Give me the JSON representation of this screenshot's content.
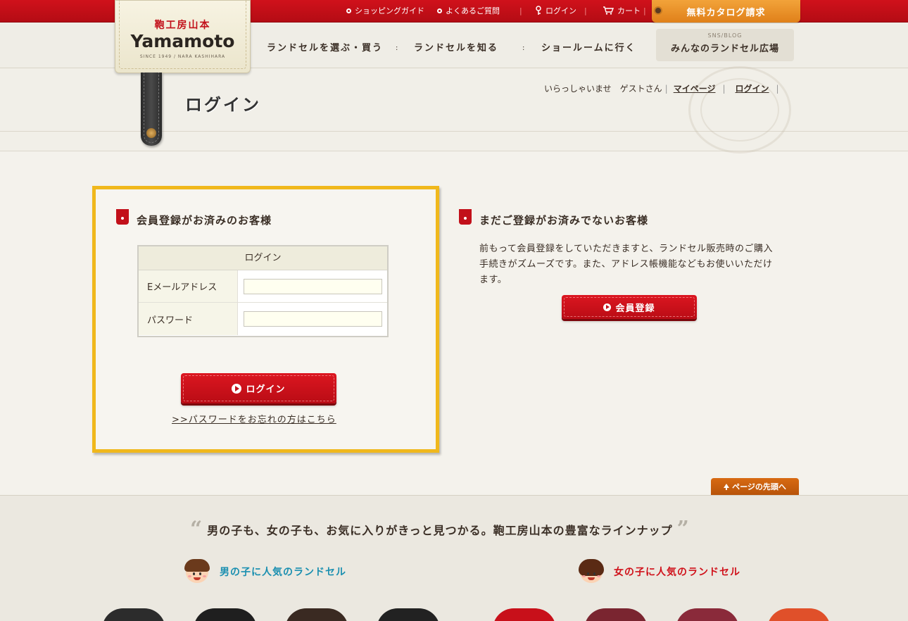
{
  "topbar": {
    "links": [
      {
        "label": "ショッピングガイド"
      },
      {
        "label": "よくあるご質問"
      },
      {
        "label": "ログイン"
      },
      {
        "label": "カート"
      }
    ],
    "catalog_label": "無料カタログ請求"
  },
  "logo": {
    "jp": "鞄工房山本",
    "en": "Yamamoto",
    "since": "SINCE 1949 / NARA KASHIHARA"
  },
  "mainnav": [
    {
      "label": "ランドセルを選ぶ・買う"
    },
    {
      "label": "ランドセルを知る"
    },
    {
      "label": "ショールームに行く"
    }
  ],
  "sns": {
    "small": "SNS/BLOG",
    "label": "みんなのランドセル広場"
  },
  "page_title": "ログイン",
  "greeting": {
    "text": "いらっしゃいませ　ゲストさん",
    "mypage": "マイページ",
    "login": "ログイン"
  },
  "member": {
    "heading": "会員登録がお済みのお客様",
    "table_header": "ログイン",
    "email_label": "Eメールアドレス",
    "email_value": "",
    "password_label": "パスワード",
    "password_value": "",
    "login_button": "ログイン",
    "forgot_link": ">>パスワードをお忘れの方はこちら"
  },
  "guest": {
    "heading": "まだご登録がお済みでないお客様",
    "intro": "前もって会員登録をしていただきますと、ランドセル販売時のご購入手続きがズムーズです。また、アドレス帳機能などもお使いいただけます。",
    "register_button": "会員登録"
  },
  "pagetop_label": "ページの先頭へ",
  "lineup": {
    "title": "男の子も、女の子も、お気に入りがきっと見つかる。鞄工房山本の豊富なラインナップ",
    "boys_label": "男の子に人気のランドセル",
    "girls_label": "女の子に人気のランドセル"
  },
  "colors": {
    "brand_red": "#c2101a",
    "accent_orange": "#e8921f",
    "highlight_yellow": "#f0b81c",
    "boys_blue": "#1a8fb0",
    "girls_red": "#d0121b"
  }
}
